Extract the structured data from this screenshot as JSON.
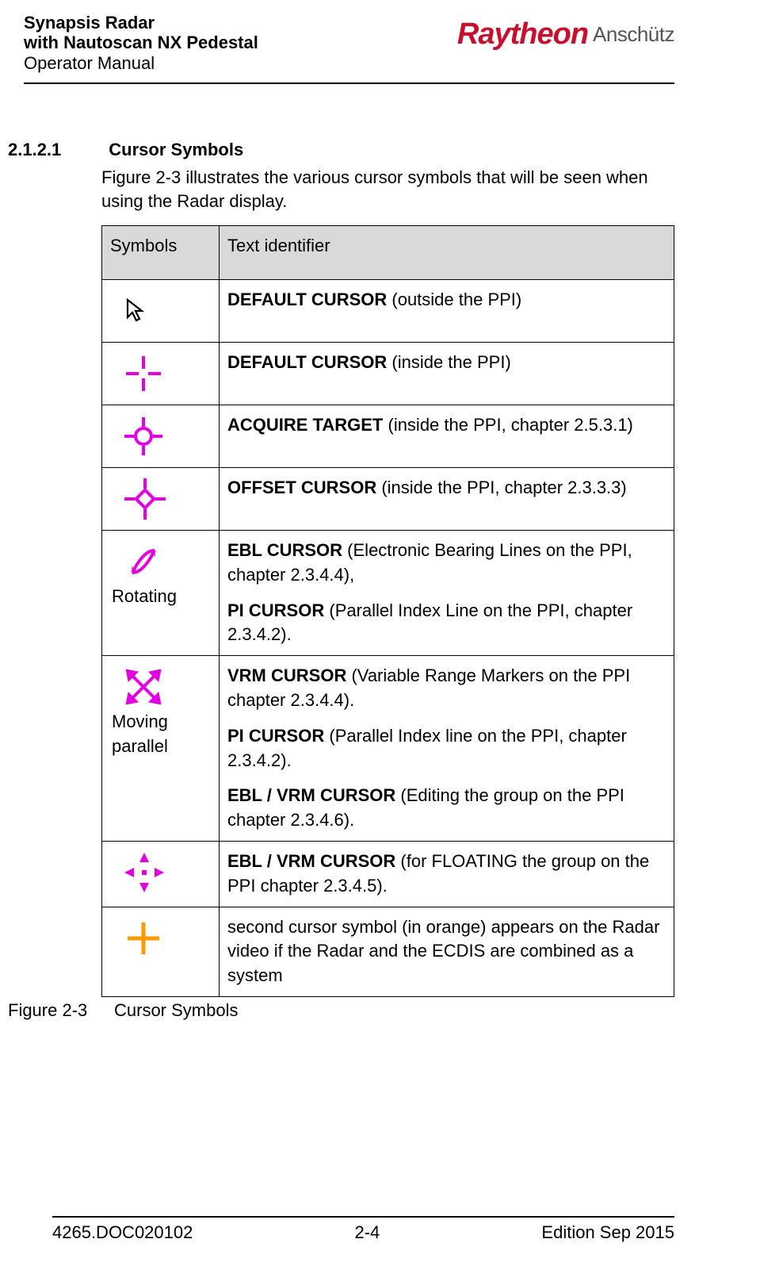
{
  "header": {
    "title_l1": "Synapsis Radar",
    "title_l2": "with Nautoscan NX Pedestal",
    "title_l3": "Operator Manual",
    "logo_brand": "Raytheon",
    "logo_sub": "Anschütz"
  },
  "section": {
    "number": "2.1.2.1",
    "title": "Cursor Symbols",
    "intro": "Figure 2-3 illustrates the various cursor symbols that will be seen when using the Radar display."
  },
  "table": {
    "head_symbols": "Symbols",
    "head_text": "Text identifier",
    "rows": [
      {
        "icon": "arrow-cursor",
        "caption": "",
        "desc": [
          {
            "bold": "DEFAULT CURSOR",
            "plain": " (outside the PPI)"
          }
        ]
      },
      {
        "icon": "crosshair-split",
        "caption": "",
        "desc": [
          {
            "bold": "DEFAULT CURSOR",
            "plain": " (inside the PPI)"
          }
        ]
      },
      {
        "icon": "acquire-target",
        "caption": "",
        "desc": [
          {
            "bold": "ACQUIRE TARGET",
            "plain": " (inside the PPI, chapter 2.5.3.1)"
          }
        ]
      },
      {
        "icon": "offset-diamond",
        "caption": "",
        "desc": [
          {
            "bold": "OFFSET CURSOR",
            "plain": " (inside the PPI, chapter 2.3.3.3)"
          }
        ]
      },
      {
        "icon": "rotating",
        "caption": "Rotating",
        "desc": [
          {
            "bold": "EBL CURSOR",
            "plain": " (Electronic Bearing Lines on the PPI, chapter 2.3.4.4),"
          },
          {
            "bold": "PI CURSOR",
            "plain": " (Parallel Index Line on the PPI, chapter 2.3.4.2)."
          }
        ]
      },
      {
        "icon": "move-diag",
        "caption": "Moving parallel",
        "desc": [
          {
            "bold": "VRM CURSOR",
            "plain": " (Variable Range Markers on the PPI chapter 2.3.4.4)."
          },
          {
            "bold": "PI CURSOR",
            "plain": " (Parallel Index line on the PPI, chapter 2.3.4.2)."
          },
          {
            "bold": "EBL / VRM CURSOR",
            "plain": " (Editing the group on the PPI chapter 2.3.4.6)."
          }
        ]
      },
      {
        "icon": "move-ortho",
        "caption": "",
        "desc": [
          {
            "bold": "EBL / VRM CURSOR",
            "plain": " (for FLOATING the group on the PPI chapter 2.3.4.5)."
          }
        ]
      },
      {
        "icon": "orange-plus",
        "caption": "",
        "desc": [
          {
            "bold": "",
            "plain": "second cursor symbol (in orange) appears on the Radar video if the Radar and the ECDIS are combined as a system"
          }
        ]
      }
    ]
  },
  "figure": {
    "num": "Figure 2-3",
    "cap": "Cursor Symbols"
  },
  "footer": {
    "left": "4265.DOC020102",
    "center": "2-4",
    "right": "Edition Sep 2015"
  }
}
